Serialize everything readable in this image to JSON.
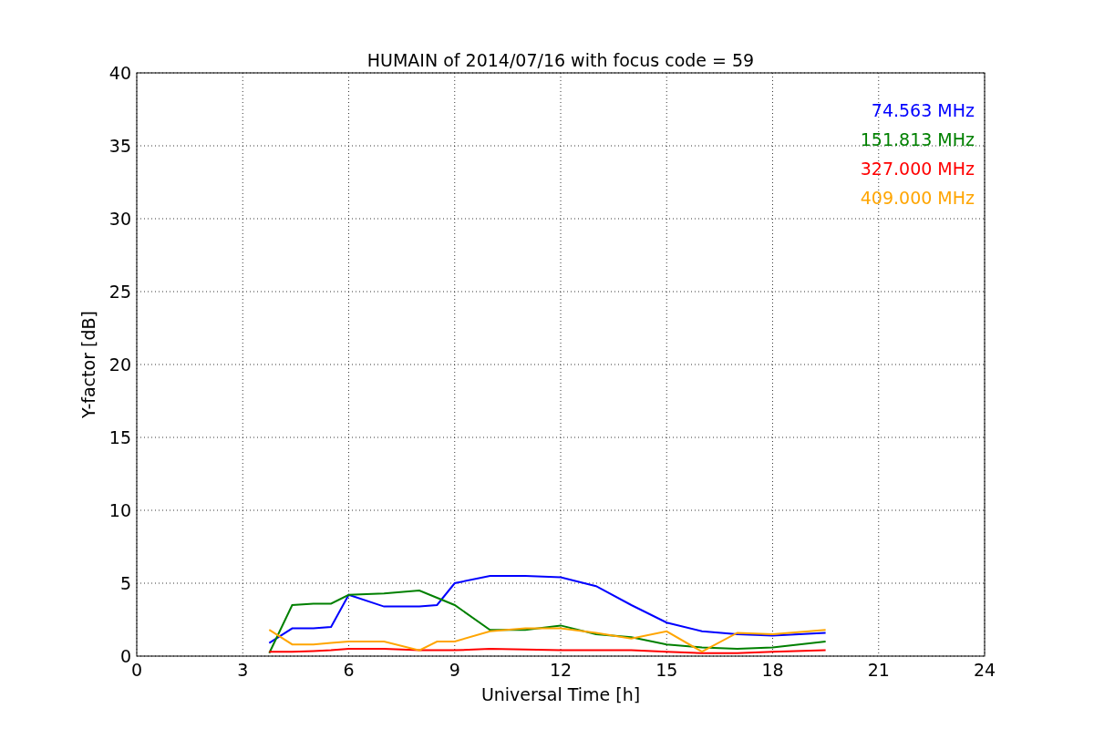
{
  "chart_data": {
    "type": "line",
    "title": "HUMAIN of 2014/07/16 with focus code = 59",
    "xlabel": "Universal Time [h]",
    "ylabel": "Y-factor [dB]",
    "x": [
      3.75,
      4.4,
      5,
      5.5,
      6,
      7,
      8,
      8.5,
      9,
      10,
      11,
      12,
      13,
      14,
      15,
      16,
      17,
      18,
      19.5
    ],
    "series": [
      {
        "name": "74.563 MHz",
        "color": "#0000ff",
        "values": [
          0.9,
          1.9,
          1.9,
          2.0,
          4.2,
          3.4,
          3.4,
          3.5,
          5.0,
          5.5,
          5.5,
          5.4,
          4.8,
          3.5,
          2.3,
          1.7,
          1.5,
          1.4,
          1.6
        ]
      },
      {
        "name": "151.813 MHz",
        "color": "#008000",
        "values": [
          0.2,
          3.5,
          3.6,
          3.6,
          4.2,
          4.3,
          4.5,
          4.0,
          3.5,
          1.8,
          1.8,
          2.1,
          1.5,
          1.3,
          0.8,
          0.6,
          0.5,
          0.6,
          1.0
        ]
      },
      {
        "name": "327.000 MHz",
        "color": "#ff0000",
        "values": [
          0.3,
          0.3,
          0.35,
          0.4,
          0.5,
          0.5,
          0.4,
          0.4,
          0.4,
          0.5,
          0.45,
          0.4,
          0.4,
          0.4,
          0.3,
          0.2,
          0.2,
          0.3,
          0.4
        ]
      },
      {
        "name": "409.000 MHz",
        "color": "#ffa500",
        "values": [
          1.8,
          0.8,
          0.8,
          0.9,
          1.0,
          1.0,
          0.4,
          1.0,
          1.0,
          1.7,
          1.9,
          1.9,
          1.6,
          1.2,
          1.7,
          0.3,
          1.6,
          1.5,
          1.8
        ]
      }
    ],
    "xlim": [
      0,
      24
    ],
    "ylim": [
      0,
      40
    ],
    "xticks": [
      0,
      3,
      6,
      9,
      12,
      15,
      18,
      21,
      24
    ],
    "yticks": [
      0,
      5,
      10,
      15,
      20,
      25,
      30,
      35,
      40
    ],
    "grid": true
  }
}
